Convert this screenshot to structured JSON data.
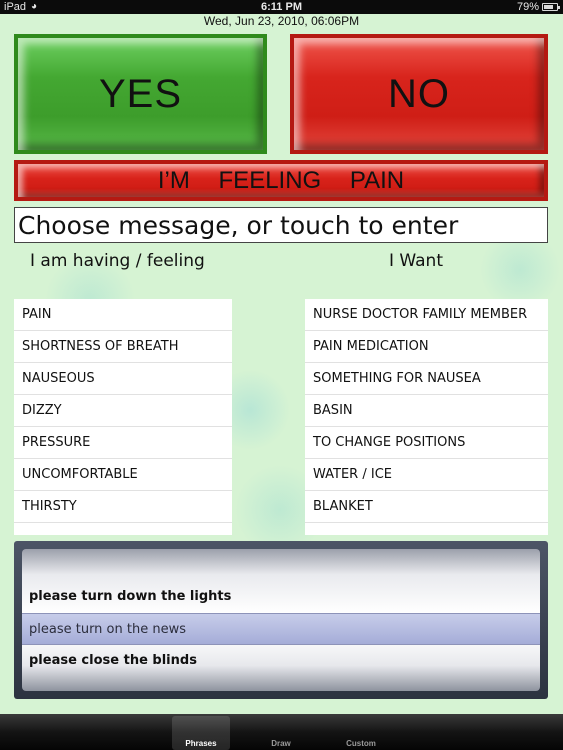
{
  "status_bar": {
    "carrier": "iPad",
    "time": "6:11 PM",
    "battery": "79%",
    "battery_level": 0.79
  },
  "datetime": "Wed, Jun 23, 2010, 06:06PM",
  "buttons": {
    "yes": "YES",
    "no": "NO",
    "feeling_pain": "I’M FEELING PAIN"
  },
  "message_input": {
    "placeholder": "Choose message, or touch to enter",
    "value": ""
  },
  "columns": {
    "left_heading": "I am having / feeling",
    "right_heading": "I Want"
  },
  "feeling_list": [
    "PAIN",
    "SHORTNESS OF BREATH",
    "NAUSEOUS",
    "DIZZY",
    "PRESSURE",
    "UNCOMFORTABLE",
    "THIRSTY"
  ],
  "want_list": [
    "NURSE DOCTOR FAMILY MEMBER",
    "PAIN MEDICATION",
    "SOMETHING FOR NAUSEA",
    "BASIN",
    "TO CHANGE POSITIONS",
    "WATER / ICE",
    "BLANKET"
  ],
  "picker": {
    "options": [
      "please turn down the lights",
      "please turn on the news",
      "please close the blinds"
    ],
    "selected": "please turn on the news"
  },
  "tabs": {
    "phrases": "Phrases",
    "draw": "Draw",
    "custom": "Custom"
  },
  "colors": {
    "background": "#d6f3d3",
    "yes_green": "#44a832",
    "no_red": "#d8241c"
  }
}
